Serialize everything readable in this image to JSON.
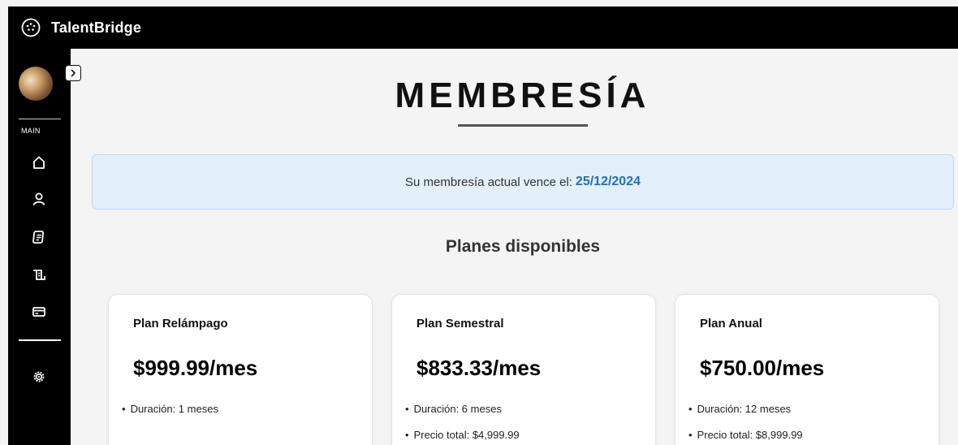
{
  "app": {
    "brand": "TalentBridge"
  },
  "sidebar": {
    "section_label": "MAIN",
    "nav": [
      {
        "icon": "home-icon"
      },
      {
        "icon": "user-icon"
      },
      {
        "icon": "document-icon"
      },
      {
        "icon": "scroll-icon"
      },
      {
        "icon": "credit-card-icon"
      }
    ],
    "settings_icon": "gear-icon"
  },
  "page": {
    "title": "MEMBRESÍA",
    "alert": {
      "text": "Su membresía actual vence el:",
      "date": "25/12/2024"
    },
    "plans_heading": "Planes disponibles",
    "plans": [
      {
        "name": "Plan Relámpago",
        "price": "$999.99/mes",
        "features": [
          "Duración: 1 meses"
        ]
      },
      {
        "name": "Plan Semestral",
        "price": "$833.33/mes",
        "features": [
          "Duración: 6 meses",
          "Precio total: $4,999.99"
        ]
      },
      {
        "name": "Plan Anual",
        "price": "$750.00/mes",
        "features": [
          "Duración: 12 meses",
          "Precio total: $8,999.99"
        ]
      }
    ]
  },
  "colors": {
    "accent": "#1c6fc4",
    "alert_bg": "#e3f0fc",
    "sidebar_bg": "#000000"
  }
}
